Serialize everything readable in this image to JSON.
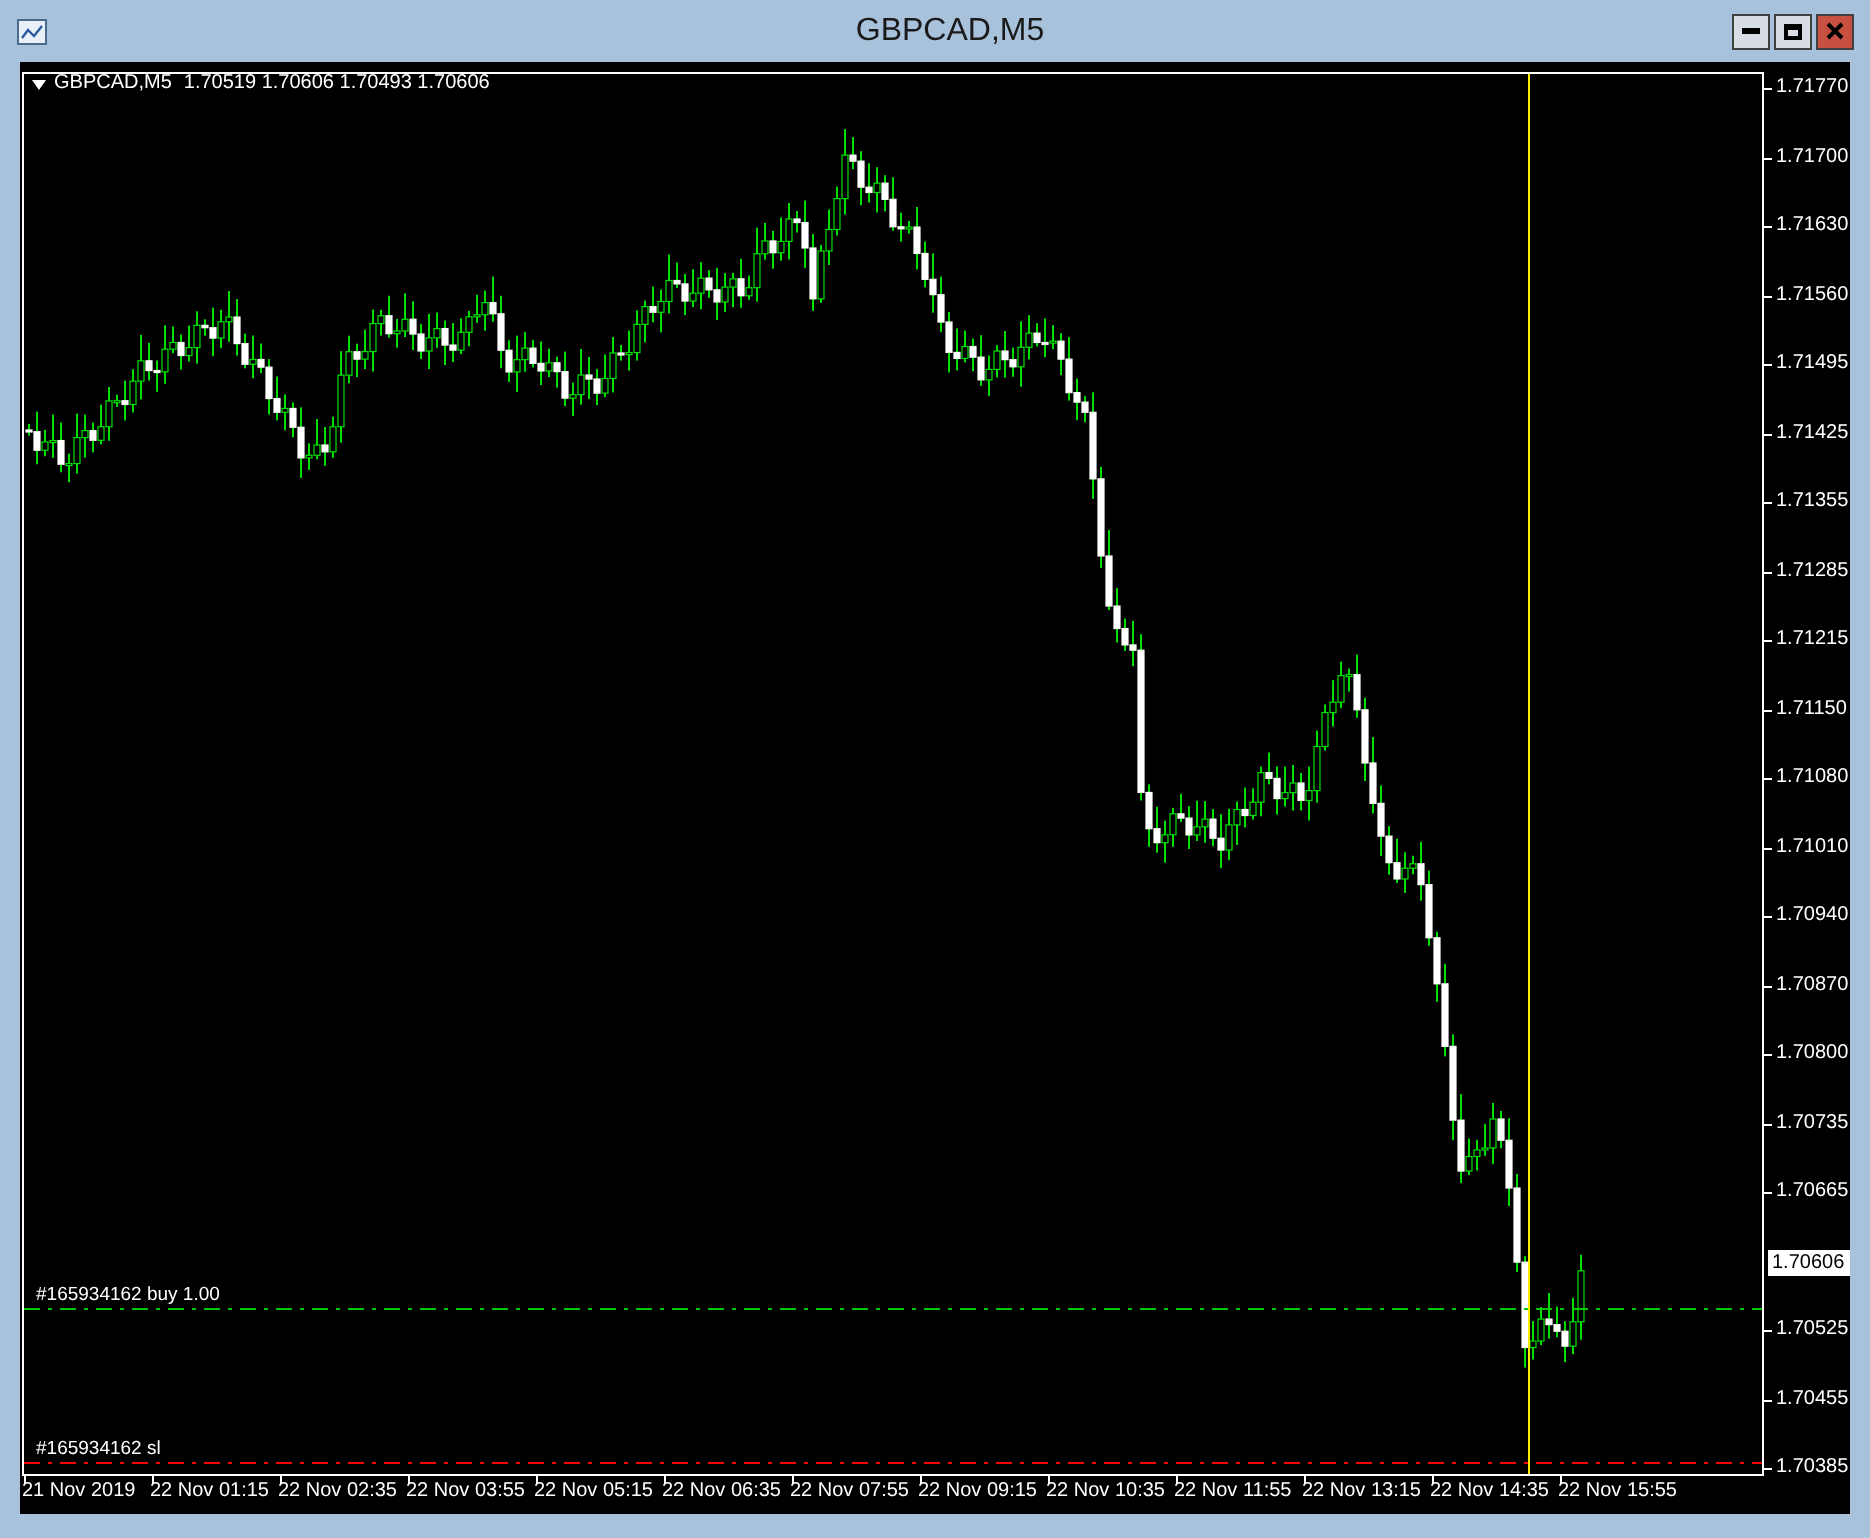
{
  "window": {
    "title": "GBPCAD,M5"
  },
  "chart": {
    "symbol": "GBPCAD,M5",
    "ohlc": "1.70519 1.70606 1.70493 1.70606",
    "price_axis": [
      {
        "label": "1.71770",
        "kind": "tick"
      },
      {
        "label": "1.71700",
        "kind": "tick"
      },
      {
        "label": "1.71630",
        "kind": "tick"
      },
      {
        "label": "1.71560",
        "kind": "tick"
      },
      {
        "label": "1.71495",
        "kind": "tick"
      },
      {
        "label": "1.71425",
        "kind": "tick"
      },
      {
        "label": "1.71355",
        "kind": "tick"
      },
      {
        "label": "1.71285",
        "kind": "tick"
      },
      {
        "label": "1.71215",
        "kind": "tick"
      },
      {
        "label": "1.71150",
        "kind": "tick"
      },
      {
        "label": "1.71080",
        "kind": "tick"
      },
      {
        "label": "1.71010",
        "kind": "tick"
      },
      {
        "label": "1.70940",
        "kind": "tick"
      },
      {
        "label": "1.70870",
        "kind": "tick"
      },
      {
        "label": "1.70800",
        "kind": "tick"
      },
      {
        "label": "1.70735",
        "kind": "tick"
      },
      {
        "label": "1.70665",
        "kind": "tick"
      },
      {
        "label": "1.70606",
        "kind": "current"
      },
      {
        "label": "1.70525",
        "kind": "tick"
      },
      {
        "label": "1.70455",
        "kind": "tick"
      },
      {
        "label": "1.70385",
        "kind": "tick"
      }
    ],
    "time_axis": [
      "21 Nov 2019",
      "22 Nov 01:15",
      "22 Nov 02:35",
      "22 Nov 03:55",
      "22 Nov 05:15",
      "22 Nov 06:35",
      "22 Nov 07:55",
      "22 Nov 09:15",
      "22 Nov 10:35",
      "22 Nov 11:55",
      "22 Nov 13:15",
      "22 Nov 14:35",
      "22 Nov 15:55"
    ],
    "order_lines": [
      {
        "label": "#165934162 buy 1.00",
        "kind": "entry",
        "color": "#00c800"
      },
      {
        "label": "#165934162 sl",
        "kind": "stop",
        "color": "#ff0000"
      }
    ]
  }
}
